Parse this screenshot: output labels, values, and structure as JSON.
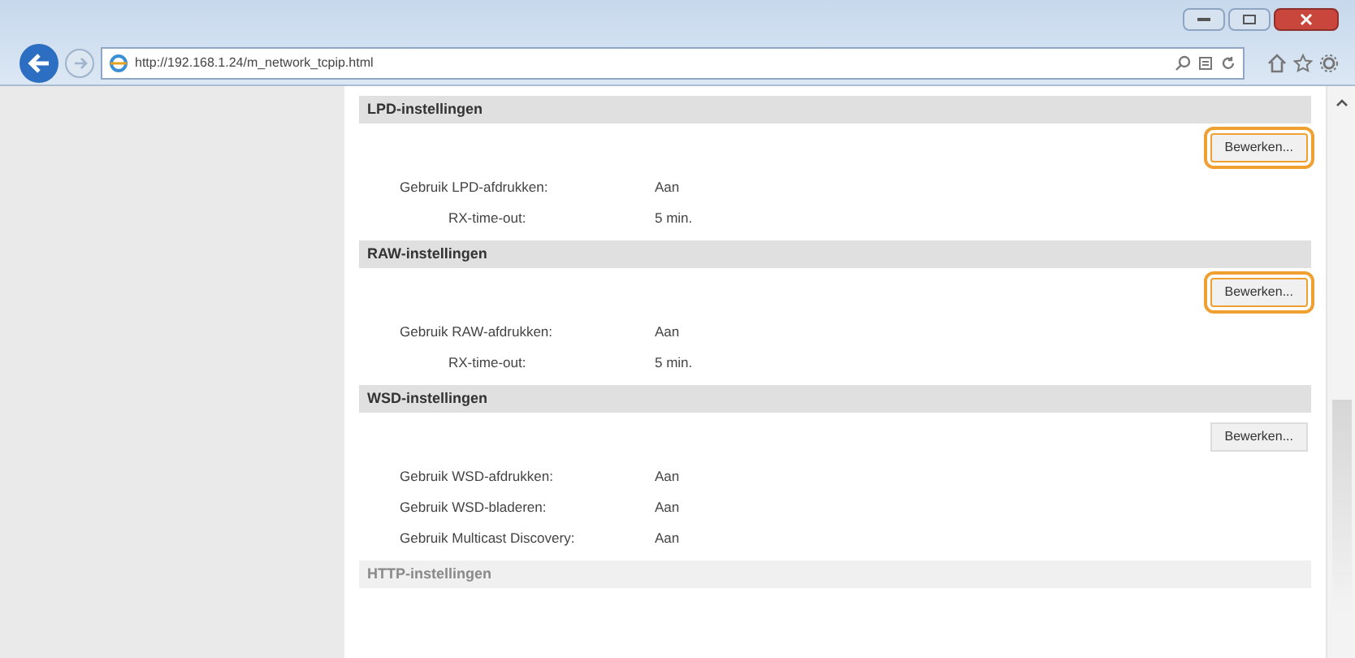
{
  "browser": {
    "url": "http://192.168.1.24/m_network_tcpip.html"
  },
  "sections": [
    {
      "title": "LPD-instellingen",
      "faded": false,
      "button": {
        "label": "Bewerken...",
        "highlighted": true
      },
      "rows": [
        {
          "label": "Gebruik LPD-afdrukken:",
          "value": "Aan",
          "indented": false
        },
        {
          "label": "RX-time-out:",
          "value": "5 min.",
          "indented": true
        }
      ]
    },
    {
      "title": "RAW-instellingen",
      "faded": false,
      "button": {
        "label": "Bewerken...",
        "highlighted": true
      },
      "rows": [
        {
          "label": "Gebruik RAW-afdrukken:",
          "value": "Aan",
          "indented": false
        },
        {
          "label": "RX-time-out:",
          "value": "5 min.",
          "indented": true
        }
      ]
    },
    {
      "title": "WSD-instellingen",
      "faded": false,
      "button": {
        "label": "Bewerken...",
        "highlighted": false
      },
      "rows": [
        {
          "label": "Gebruik WSD-afdrukken:",
          "value": "Aan",
          "indented": false
        },
        {
          "label": "Gebruik WSD-bladeren:",
          "value": "Aan",
          "indented": false
        },
        {
          "label": "Gebruik Multicast Discovery:",
          "value": "Aan",
          "indented": false
        }
      ]
    },
    {
      "title": "HTTP-instellingen",
      "faded": true
    }
  ]
}
